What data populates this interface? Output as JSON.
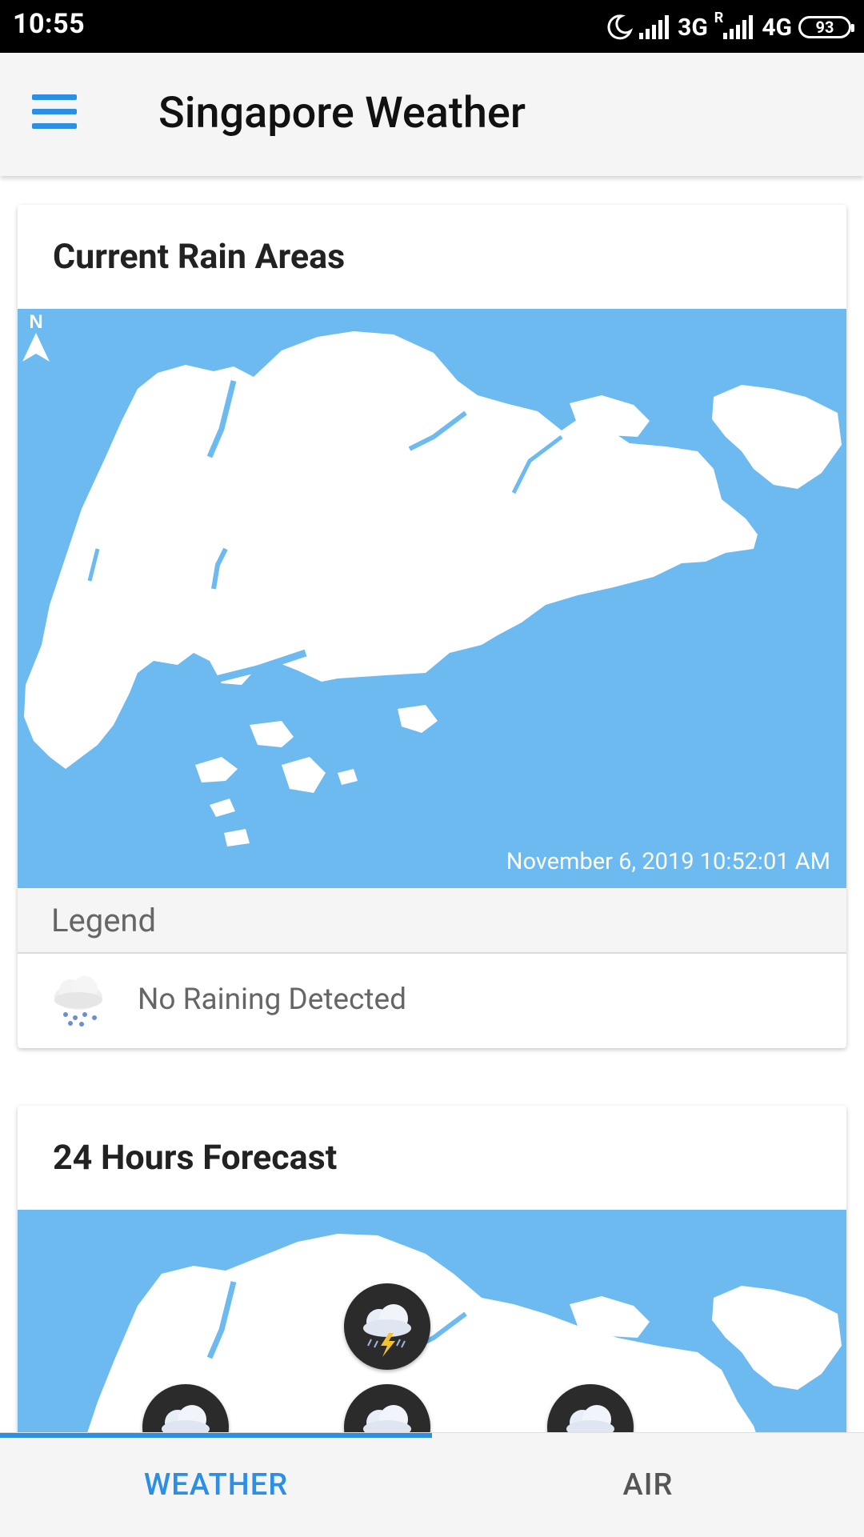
{
  "status_bar": {
    "time": "10:55",
    "network_1": "3G",
    "roaming": "R",
    "network_2": "4G",
    "battery": "93"
  },
  "app_bar": {
    "title": "Singapore Weather",
    "menu_icon": "hamburger-menu-icon"
  },
  "rain_card": {
    "title": "Current Rain Areas",
    "timestamp": "November 6, 2019 10:52:01 AM",
    "north_label": "N",
    "legend_header": "Legend",
    "legend_items": [
      {
        "icon": "rain-cloud-icon",
        "label": "No Raining Detected"
      }
    ]
  },
  "forecast_card": {
    "title": "24 Hours Forecast",
    "icons": [
      "thunderstorm-icon",
      "thunderstorm-icon",
      "thunderstorm-icon",
      "thunderstorm-icon"
    ]
  },
  "bottom_nav": {
    "tabs": [
      {
        "label": "WEATHER",
        "active": true
      },
      {
        "label": "AIR",
        "active": false
      }
    ]
  },
  "colors": {
    "accent": "#2d8fe3",
    "map_water": "#6cbaf0",
    "status_bar": "#000000"
  }
}
